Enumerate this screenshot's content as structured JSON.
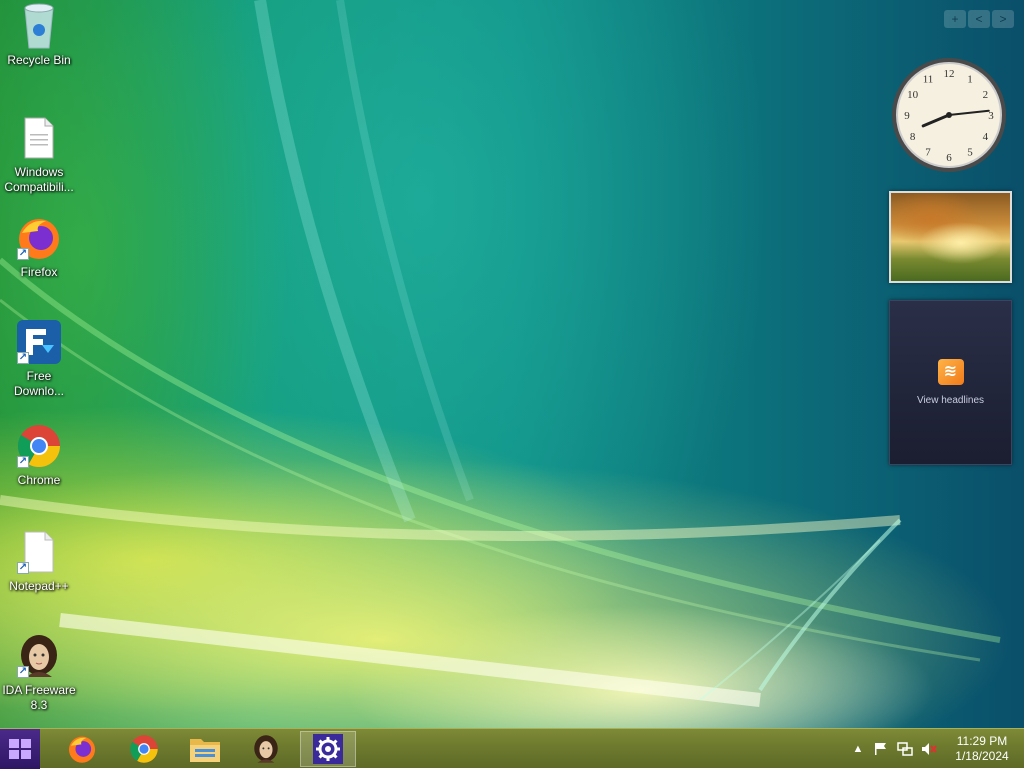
{
  "desktop": {
    "icons": [
      {
        "label": "Recycle Bin",
        "icon": "recycle-bin-icon"
      },
      {
        "label": "Windows\nCompatibili...",
        "icon": "document-icon"
      },
      {
        "label": "Firefox",
        "icon": "firefox-icon"
      },
      {
        "label": "Free\nDownlo...",
        "icon": "free-download-manager-icon"
      },
      {
        "label": "Chrome",
        "icon": "chrome-icon"
      },
      {
        "label": "Notepad++",
        "icon": "notepad-plus-plus-icon"
      },
      {
        "label": "IDA Freeware\n8.3",
        "icon": "ida-freeware-icon"
      }
    ]
  },
  "gadgets": {
    "clock": {
      "hour": 8,
      "minute": 14,
      "icon": "analog-clock-icon"
    },
    "slideshow": {
      "icon": "photo-slideshow-icon"
    },
    "feed": {
      "label": "View headlines",
      "icon": "rss-feed-icon"
    },
    "sidebar_controls": [
      "+",
      "<",
      ">"
    ]
  },
  "taskbar": {
    "start": {
      "icon": "windows-start-icon"
    },
    "pinned": [
      {
        "name": "firefox",
        "icon": "firefox-icon"
      },
      {
        "name": "chrome",
        "icon": "chrome-icon"
      },
      {
        "name": "file-explorer",
        "icon": "folder-icon"
      },
      {
        "name": "ida-freeware",
        "icon": "ida-freeware-icon"
      },
      {
        "name": "settings",
        "icon": "gear-icon",
        "active": true
      }
    ],
    "tray": {
      "time": "11:29 PM",
      "date": "1/18/2024",
      "icons": [
        "chevron-up-icon",
        "flag-icon",
        "network-icon",
        "volume-muted-icon"
      ]
    }
  },
  "colors": {
    "taskbar": "#6d7a2e",
    "start": "#2e1664",
    "settings_gear": "#3b2a9a"
  }
}
